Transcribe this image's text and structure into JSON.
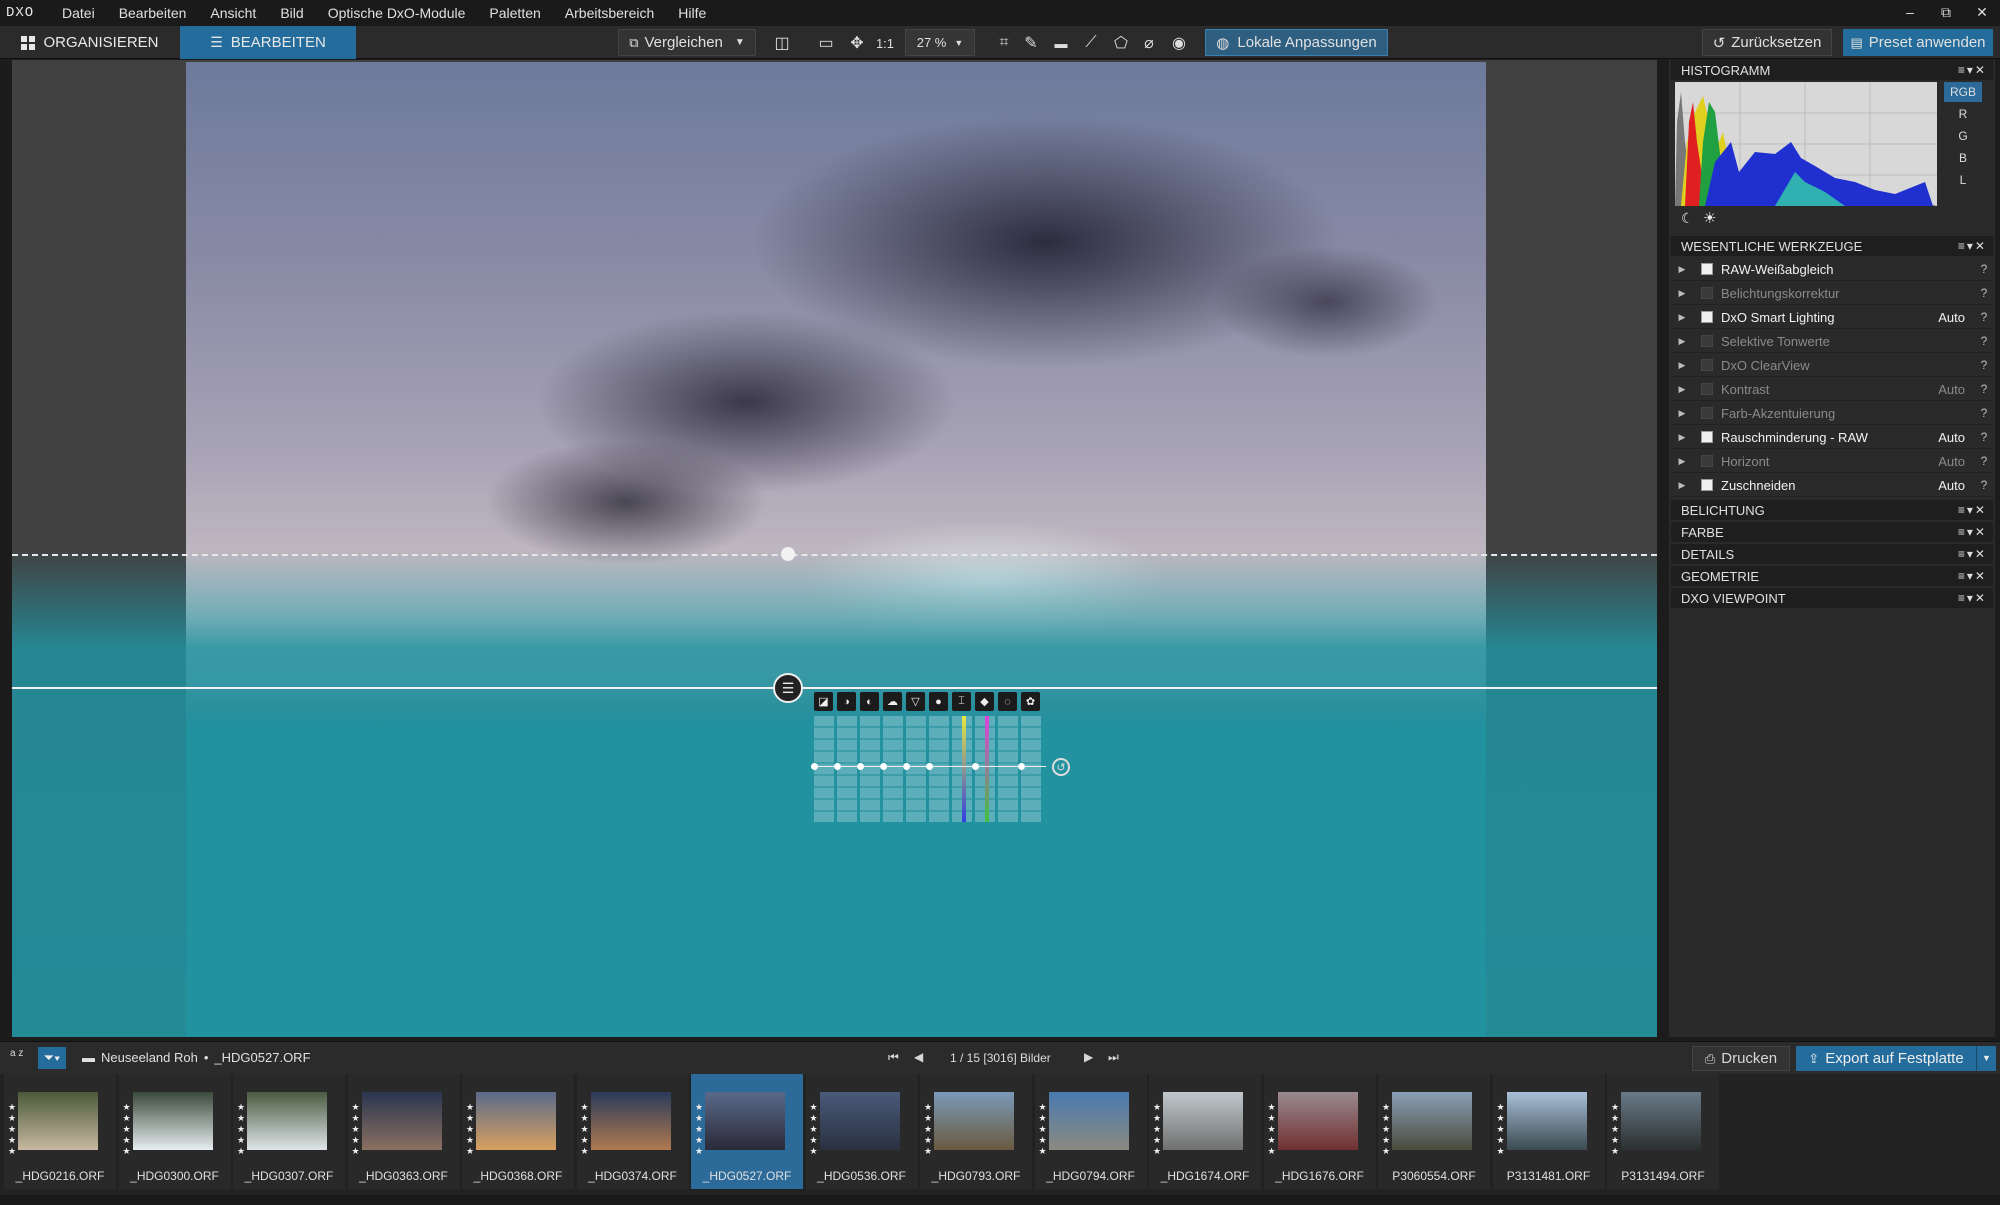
{
  "app": {
    "logo": "DXO"
  },
  "menu": [
    "Datei",
    "Bearbeiten",
    "Ansicht",
    "Bild",
    "Optische DxO-Module",
    "Paletten",
    "Arbeitsbereich",
    "Hilfe"
  ],
  "window_controls": [
    "–",
    "⧉",
    "✕"
  ],
  "toolbar": {
    "tab_organize": "ORGANISIEREN",
    "tab_edit": "BEARBEITEN",
    "compare": "Vergleichen",
    "ratio": "1:1",
    "zoom": "27 %",
    "local_adjust": "Lokale Anpassungen",
    "reset": "Zurücksetzen",
    "preset": "Preset anwenden"
  },
  "panels": {
    "histogram": {
      "title": "HISTOGRAMM",
      "channels": [
        "RGB",
        "R",
        "G",
        "B",
        "L"
      ],
      "selected": "RGB"
    },
    "essential": {
      "title": "WESENTLICHE WERKZEUGE",
      "tools": [
        {
          "label": "RAW-Weißabgleich",
          "auto": "",
          "enabled": true
        },
        {
          "label": "Belichtungskorrektur",
          "auto": "",
          "enabled": false
        },
        {
          "label": "DxO Smart Lighting",
          "auto": "Auto",
          "enabled": true
        },
        {
          "label": "Selektive Tonwerte",
          "auto": "",
          "enabled": false
        },
        {
          "label": "DxO ClearView",
          "auto": "",
          "enabled": false
        },
        {
          "label": "Kontrast",
          "auto": "Auto",
          "enabled": false
        },
        {
          "label": "Farb-Akzentuierung",
          "auto": "",
          "enabled": false
        },
        {
          "label": "Rauschminderung - RAW",
          "auto": "Auto",
          "enabled": true
        },
        {
          "label": "Horizont",
          "auto": "Auto",
          "enabled": false
        },
        {
          "label": "Zuschneiden",
          "auto": "Auto",
          "enabled": true
        }
      ]
    },
    "collapsed": [
      "BELICHTUNG",
      "FARBE",
      "DETAILS",
      "GEOMETRIE",
      "DXO VIEWPOINT"
    ]
  },
  "bottombar": {
    "sort": "a z",
    "folder": "Neuseeland Roh",
    "separator": "•",
    "file": "_HDG0527.ORF",
    "counter": "1 / 15 [3016] Bilder",
    "print": "Drucken",
    "export": "Export auf Festplatte"
  },
  "filmstrip": [
    {
      "name": "_HDG0216.ORF",
      "colors": [
        "#4a5a3a",
        "#c8b8a0"
      ],
      "selected": false
    },
    {
      "name": "_HDG0300.ORF",
      "colors": [
        "#3a4a3a",
        "#e8eef0"
      ],
      "selected": false
    },
    {
      "name": "_HDG0307.ORF",
      "colors": [
        "#4a5a40",
        "#dfe6ea"
      ],
      "selected": false
    },
    {
      "name": "_HDG0363.ORF",
      "colors": [
        "#2a3550",
        "#8a7060"
      ],
      "selected": false
    },
    {
      "name": "_HDG0368.ORF",
      "colors": [
        "#5a6a8a",
        "#d8a060"
      ],
      "selected": false
    },
    {
      "name": "_HDG0374.ORF",
      "colors": [
        "#2a3a5a",
        "#b07a50"
      ],
      "selected": false
    },
    {
      "name": "_HDG0527.ORF",
      "colors": [
        "#5a6a8a",
        "#2a2a38"
      ],
      "selected": true
    },
    {
      "name": "_HDG0536.ORF",
      "colors": [
        "#4a5a7a",
        "#2a3040"
      ],
      "selected": false
    },
    {
      "name": "_HDG0793.ORF",
      "colors": [
        "#7a9ab8",
        "#6a5a40"
      ],
      "selected": false
    },
    {
      "name": "_HDG0794.ORF",
      "colors": [
        "#4a7ab0",
        "#8a8a80"
      ],
      "selected": false
    },
    {
      "name": "_HDG1674.ORF",
      "colors": [
        "#c0c8cc",
        "#707070"
      ],
      "selected": false
    },
    {
      "name": "_HDG1676.ORF",
      "colors": [
        "#9a8a90",
        "#703030"
      ],
      "selected": false
    },
    {
      "name": "P3060554.ORF",
      "colors": [
        "#8aa0b8",
        "#4a4a3a"
      ],
      "selected": false
    },
    {
      "name": "P3131481.ORF",
      "colors": [
        "#a8c0d8",
        "#3a4a50"
      ],
      "selected": false
    },
    {
      "name": "P3131494.ORF",
      "colors": [
        "#6a7a88",
        "#2a3030"
      ],
      "selected": false
    }
  ]
}
